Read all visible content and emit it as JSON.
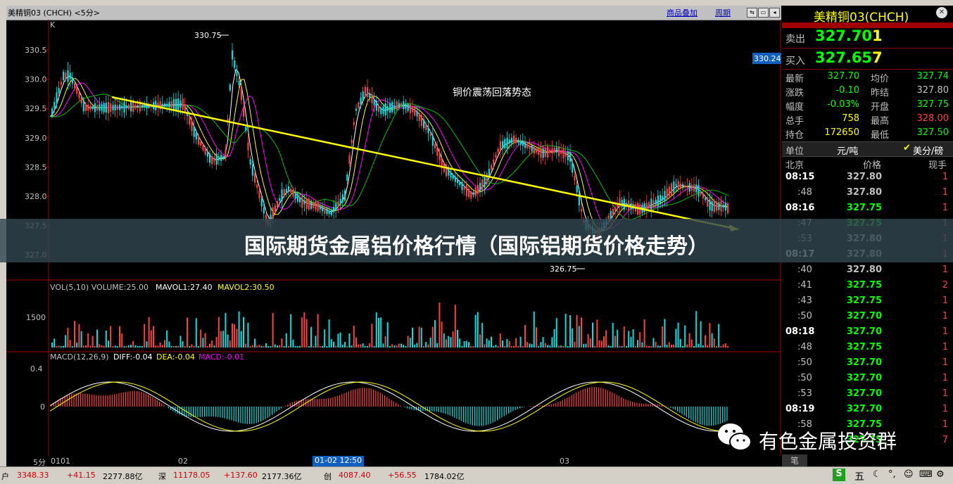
{
  "window": {
    "title": "美精铜03 (CHCH) <5分>",
    "buttons": [
      "商品叠加",
      "周期"
    ]
  },
  "chart": {
    "k_label": "K",
    "price_axis": [
      "330.5",
      "330.0",
      "329.5",
      "329.0",
      "328.5",
      "328.0",
      "327.5",
      "327.0"
    ],
    "high_marker": "330.75",
    "low_marker": "326.75",
    "current_price_tag": "330.24",
    "annotation": "铜价震荡回落势态",
    "vol_legend": {
      "a": "VOL(5,10) VOLUME:25.00",
      "b": "MAVOL1:27.40",
      "c": "MAVOL2:30.50"
    },
    "vol_axis": "1500",
    "macd_legend": {
      "a": "MACD(12,26,9)",
      "b": "DIFF:-0.04",
      "c": "DEA:-0.04",
      "d": "MACD:-0.01"
    },
    "macd_axis": [
      "0.4",
      "0"
    ],
    "time_labels": {
      "period": "5分",
      "t1": "0101",
      "t2": "02",
      "t3": "03",
      "cursor": "01-02 12:50"
    },
    "colors": {
      "up": "#ff4040",
      "down": "#00e0e0",
      "trend": "#ffff00",
      "ma1": "#ffffff",
      "ma2": "#ffff00",
      "ma3": "#ff00ff",
      "ma4": "#00c000"
    }
  },
  "status": {
    "s1_label": "户",
    "s1_v1": "3348.33",
    "s1_v2": "+41.15",
    "s1_v3": "2277.88亿",
    "s2_label": "深",
    "s2_v1": "11178.05",
    "s2_v2": "+137.60",
    "s2_v3": "2177.36亿",
    "s3_label": "创",
    "s3_v1": "4087.40",
    "s3_v2": "+56.55",
    "s3_v3": "1784.02亿",
    "tray": "五"
  },
  "quote": {
    "name": "美精铜03(CHCH)",
    "ask_label": "卖出",
    "ask_price": "327.70",
    "ask_vol": "1",
    "bid_label": "买入",
    "bid_price": "327.65",
    "bid_vol": "7",
    "rows": [
      {
        "l1": "最新",
        "v1": "327.70",
        "c1": "#00ff00",
        "l2": "均价",
        "v2": "327.74",
        "c2": "#00ff00"
      },
      {
        "l1": "涨跌",
        "v1": "-0.10",
        "c1": "#00ff00",
        "l2": "昨结",
        "v2": "327.80",
        "c2": "#c0c0c0"
      },
      {
        "l1": "幅度",
        "v1": "-0.03%",
        "c1": "#00ff00",
        "l2": "开盘",
        "v2": "327.75",
        "c2": "#00ff00"
      },
      {
        "l1": "总手",
        "v1": "758",
        "c1": "#ffff00",
        "l2": "最高",
        "v2": "328.00",
        "c2": "#ff4040"
      },
      {
        "l1": "持仓",
        "v1": "172650",
        "c1": "#ffff00",
        "l2": "最低",
        "v2": "327.50",
        "c2": "#00ff00"
      }
    ],
    "unit_label": "单位",
    "unit_value": "元/吨",
    "unit_alt": "美分/磅",
    "tick_header": {
      "place": "北京",
      "price": "价格",
      "qty": "现手"
    },
    "ticks": [
      {
        "t": "08:15",
        "p": "327.80",
        "v": "1",
        "pc": "#c0c0c0"
      },
      {
        "t": ":48",
        "p": "327.80",
        "v": "1",
        "pc": "#c0c0c0"
      },
      {
        "t": "08:16",
        "p": "327.75",
        "v": "1",
        "pc": "#00ff00"
      },
      {
        "t": ":47",
        "p": "327.75",
        "v": "1",
        "pc": "#00ff00"
      },
      {
        "t": ":53",
        "p": "327.80",
        "v": "1",
        "pc": "#c0c0c0"
      },
      {
        "t": "08:17",
        "p": "327.80",
        "v": "1",
        "pc": "#c0c0c0"
      },
      {
        "t": ":40",
        "p": "327.80",
        "v": "1",
        "pc": "#c0c0c0"
      },
      {
        "t": ":41",
        "p": "327.75",
        "v": "2",
        "pc": "#00ff00"
      },
      {
        "t": ":43",
        "p": "327.75",
        "v": "1",
        "pc": "#00ff00"
      },
      {
        "t": ":50",
        "p": "327.70",
        "v": "1",
        "pc": "#00ff00"
      },
      {
        "t": "08:18",
        "p": "327.70",
        "v": "1",
        "pc": "#00ff00"
      },
      {
        "t": ":48",
        "p": "327.75",
        "v": "1",
        "pc": "#00ff00"
      },
      {
        "t": ":50",
        "p": "327.70",
        "v": "1",
        "pc": "#00ff00"
      },
      {
        "t": ":50",
        "p": "327.70",
        "v": "1",
        "pc": "#00ff00"
      },
      {
        "t": ":53",
        "p": "327.70",
        "v": "1",
        "pc": "#00ff00"
      },
      {
        "t": "08:19",
        "p": "327.70",
        "v": "1",
        "pc": "#00ff00"
      },
      {
        "t": ":58",
        "p": "327.75",
        "v": "1",
        "pc": "#00ff00"
      },
      {
        "t": "",
        "p": "327.75",
        "v": "7",
        "pc": "#00ff00"
      }
    ],
    "footer": "笔"
  },
  "banner": {
    "title": "国际期货金属铝价格行情（国际铝期货价格走势）"
  },
  "watermark": {
    "text": "有色金属投资群"
  }
}
